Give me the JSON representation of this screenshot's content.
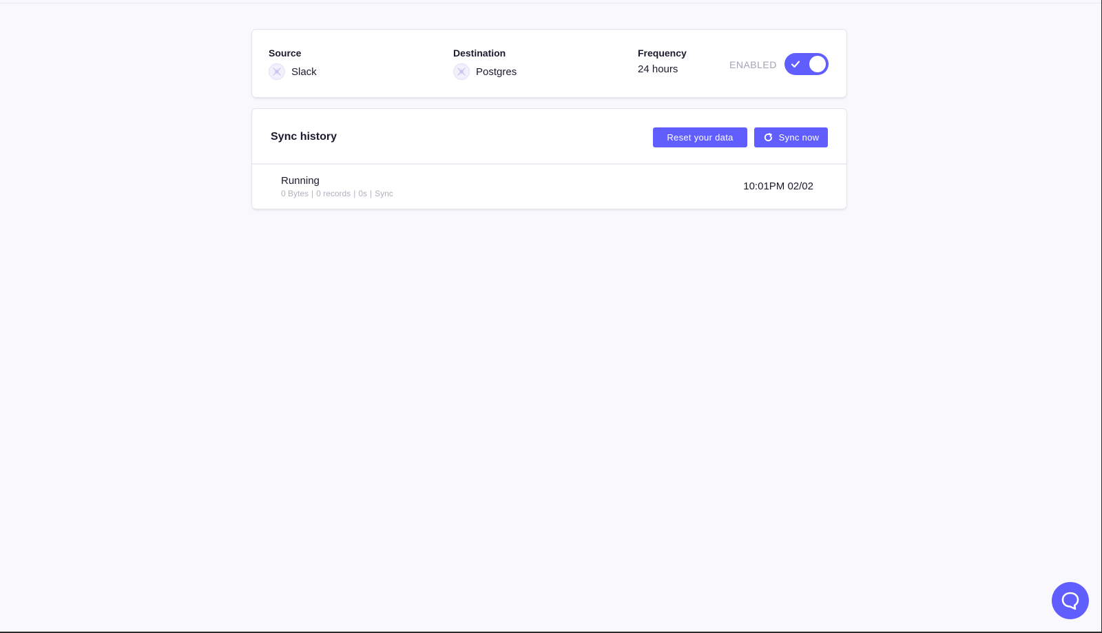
{
  "connection": {
    "source": {
      "label": "Source",
      "value": "Slack",
      "icon": "connector-icon"
    },
    "destination": {
      "label": "Destination",
      "value": "Postgres",
      "icon": "connector-icon"
    },
    "frequency": {
      "label": "Frequency",
      "value": "24 hours"
    },
    "status": {
      "label": "ENABLED",
      "enabled": true
    }
  },
  "history": {
    "title": "Sync history",
    "reset_button": "Reset your data",
    "sync_button": "Sync now",
    "rows": [
      {
        "status": "Running",
        "bytes": "0 Bytes",
        "records": "0 records",
        "duration": "0s",
        "type": "Sync",
        "time": "10:01PM 02/02"
      }
    ]
  },
  "chat": {
    "icon": "chat-bubble-icon"
  },
  "colors": {
    "accent": "#615eff",
    "background": "#f8f8fd",
    "muted": "#a3a3b8"
  }
}
